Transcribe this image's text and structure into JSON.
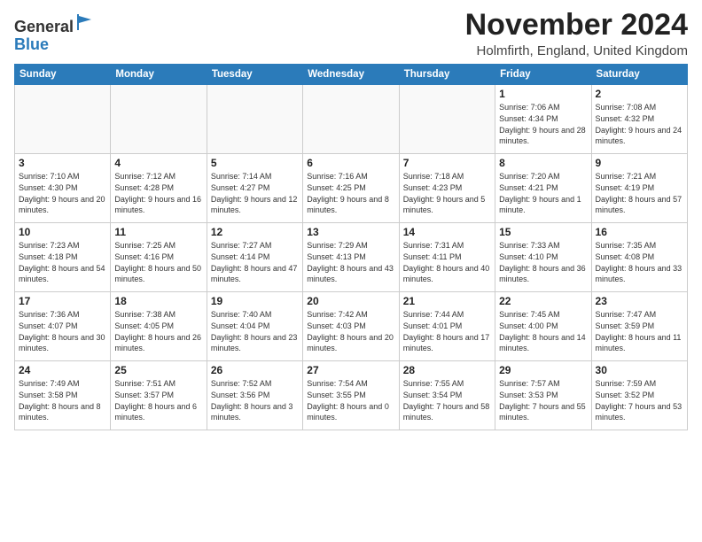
{
  "header": {
    "logo_line1": "General",
    "logo_line2": "Blue",
    "month": "November 2024",
    "location": "Holmfirth, England, United Kingdom"
  },
  "weekdays": [
    "Sunday",
    "Monday",
    "Tuesday",
    "Wednesday",
    "Thursday",
    "Friday",
    "Saturday"
  ],
  "weeks": [
    [
      {
        "day": "",
        "info": ""
      },
      {
        "day": "",
        "info": ""
      },
      {
        "day": "",
        "info": ""
      },
      {
        "day": "",
        "info": ""
      },
      {
        "day": "",
        "info": ""
      },
      {
        "day": "1",
        "info": "Sunrise: 7:06 AM\nSunset: 4:34 PM\nDaylight: 9 hours\nand 28 minutes."
      },
      {
        "day": "2",
        "info": "Sunrise: 7:08 AM\nSunset: 4:32 PM\nDaylight: 9 hours\nand 24 minutes."
      }
    ],
    [
      {
        "day": "3",
        "info": "Sunrise: 7:10 AM\nSunset: 4:30 PM\nDaylight: 9 hours\nand 20 minutes."
      },
      {
        "day": "4",
        "info": "Sunrise: 7:12 AM\nSunset: 4:28 PM\nDaylight: 9 hours\nand 16 minutes."
      },
      {
        "day": "5",
        "info": "Sunrise: 7:14 AM\nSunset: 4:27 PM\nDaylight: 9 hours\nand 12 minutes."
      },
      {
        "day": "6",
        "info": "Sunrise: 7:16 AM\nSunset: 4:25 PM\nDaylight: 9 hours\nand 8 minutes."
      },
      {
        "day": "7",
        "info": "Sunrise: 7:18 AM\nSunset: 4:23 PM\nDaylight: 9 hours\nand 5 minutes."
      },
      {
        "day": "8",
        "info": "Sunrise: 7:20 AM\nSunset: 4:21 PM\nDaylight: 9 hours\nand 1 minute."
      },
      {
        "day": "9",
        "info": "Sunrise: 7:21 AM\nSunset: 4:19 PM\nDaylight: 8 hours\nand 57 minutes."
      }
    ],
    [
      {
        "day": "10",
        "info": "Sunrise: 7:23 AM\nSunset: 4:18 PM\nDaylight: 8 hours\nand 54 minutes."
      },
      {
        "day": "11",
        "info": "Sunrise: 7:25 AM\nSunset: 4:16 PM\nDaylight: 8 hours\nand 50 minutes."
      },
      {
        "day": "12",
        "info": "Sunrise: 7:27 AM\nSunset: 4:14 PM\nDaylight: 8 hours\nand 47 minutes."
      },
      {
        "day": "13",
        "info": "Sunrise: 7:29 AM\nSunset: 4:13 PM\nDaylight: 8 hours\nand 43 minutes."
      },
      {
        "day": "14",
        "info": "Sunrise: 7:31 AM\nSunset: 4:11 PM\nDaylight: 8 hours\nand 40 minutes."
      },
      {
        "day": "15",
        "info": "Sunrise: 7:33 AM\nSunset: 4:10 PM\nDaylight: 8 hours\nand 36 minutes."
      },
      {
        "day": "16",
        "info": "Sunrise: 7:35 AM\nSunset: 4:08 PM\nDaylight: 8 hours\nand 33 minutes."
      }
    ],
    [
      {
        "day": "17",
        "info": "Sunrise: 7:36 AM\nSunset: 4:07 PM\nDaylight: 8 hours\nand 30 minutes."
      },
      {
        "day": "18",
        "info": "Sunrise: 7:38 AM\nSunset: 4:05 PM\nDaylight: 8 hours\nand 26 minutes."
      },
      {
        "day": "19",
        "info": "Sunrise: 7:40 AM\nSunset: 4:04 PM\nDaylight: 8 hours\nand 23 minutes."
      },
      {
        "day": "20",
        "info": "Sunrise: 7:42 AM\nSunset: 4:03 PM\nDaylight: 8 hours\nand 20 minutes."
      },
      {
        "day": "21",
        "info": "Sunrise: 7:44 AM\nSunset: 4:01 PM\nDaylight: 8 hours\nand 17 minutes."
      },
      {
        "day": "22",
        "info": "Sunrise: 7:45 AM\nSunset: 4:00 PM\nDaylight: 8 hours\nand 14 minutes."
      },
      {
        "day": "23",
        "info": "Sunrise: 7:47 AM\nSunset: 3:59 PM\nDaylight: 8 hours\nand 11 minutes."
      }
    ],
    [
      {
        "day": "24",
        "info": "Sunrise: 7:49 AM\nSunset: 3:58 PM\nDaylight: 8 hours\nand 8 minutes."
      },
      {
        "day": "25",
        "info": "Sunrise: 7:51 AM\nSunset: 3:57 PM\nDaylight: 8 hours\nand 6 minutes."
      },
      {
        "day": "26",
        "info": "Sunrise: 7:52 AM\nSunset: 3:56 PM\nDaylight: 8 hours\nand 3 minutes."
      },
      {
        "day": "27",
        "info": "Sunrise: 7:54 AM\nSunset: 3:55 PM\nDaylight: 8 hours\nand 0 minutes."
      },
      {
        "day": "28",
        "info": "Sunrise: 7:55 AM\nSunset: 3:54 PM\nDaylight: 7 hours\nand 58 minutes."
      },
      {
        "day": "29",
        "info": "Sunrise: 7:57 AM\nSunset: 3:53 PM\nDaylight: 7 hours\nand 55 minutes."
      },
      {
        "day": "30",
        "info": "Sunrise: 7:59 AM\nSunset: 3:52 PM\nDaylight: 7 hours\nand 53 minutes."
      }
    ]
  ]
}
